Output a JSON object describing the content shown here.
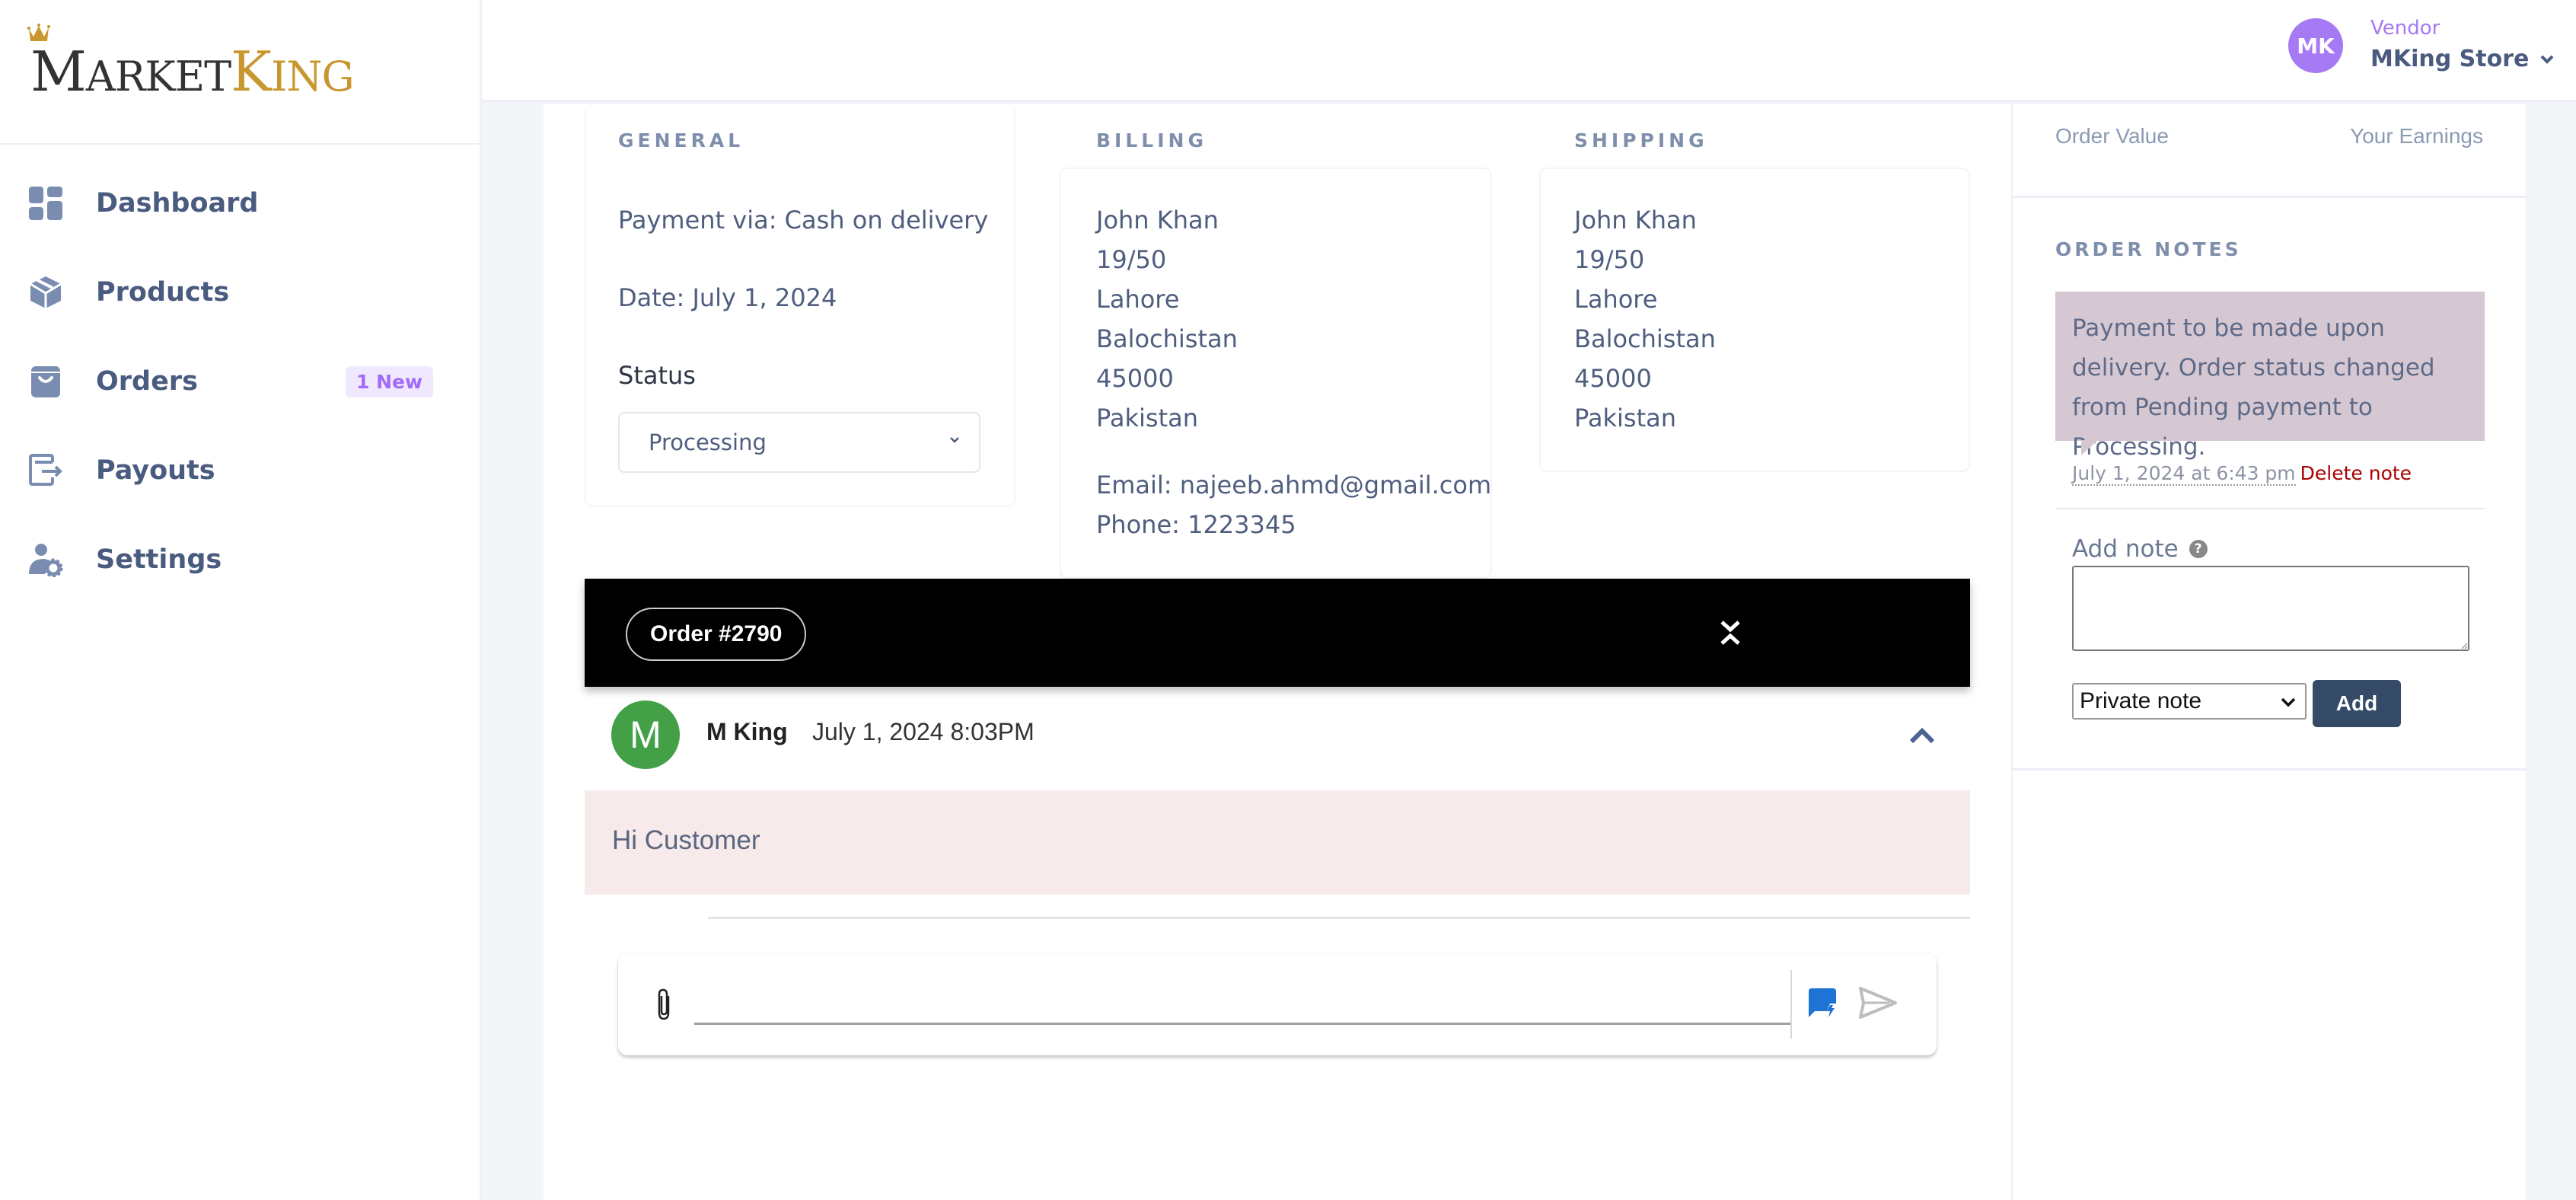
{
  "brand": {
    "name_part1_initial": "M",
    "name_part1_rest": "ARKET",
    "name_part2_initial": "K",
    "name_part2_rest": "ING",
    "primary_color": "#333333",
    "accent_color": "#c9972f"
  },
  "sidebar": {
    "items": [
      {
        "label": "Dashboard",
        "icon": "dashboard-grid-icon"
      },
      {
        "label": "Products",
        "icon": "box-icon"
      },
      {
        "label": "Orders",
        "icon": "shopping-bag-icon",
        "badge": "1 New"
      },
      {
        "label": "Payouts",
        "icon": "payout-export-icon"
      },
      {
        "label": "Settings",
        "icon": "user-settings-icon"
      }
    ]
  },
  "header": {
    "avatar_initials": "MK",
    "role": "Vendor",
    "store_name": "MKing Store",
    "avatar_color": "#a67af4"
  },
  "order": {
    "general": {
      "title": "GENERAL",
      "payment": "Payment via: Cash on delivery",
      "date": "Date: July 1, 2024",
      "status_label": "Status",
      "status_value": "Processing"
    },
    "billing": {
      "title": "BILLING",
      "lines": [
        "John Khan",
        "19/50",
        "Lahore",
        "Balochistan",
        "45000",
        "Pakistan"
      ],
      "email": "Email: najeeb.ahmd@gmail.com",
      "phone": "Phone: 1223345"
    },
    "shipping": {
      "title": "SHIPPING",
      "lines": [
        "John Khan",
        "19/50",
        "Lahore",
        "Balochistan",
        "45000",
        "Pakistan"
      ]
    }
  },
  "chat": {
    "order_pill": "Order #2790",
    "message": {
      "avatar_initial": "M",
      "avatar_color": "#43a047",
      "author": "M King",
      "timestamp": "July 1, 2024 8:03PM",
      "text": "Hi Customer"
    },
    "composer": {
      "value": "",
      "placeholder": ""
    }
  },
  "right_panel": {
    "order_value_label": "Order Value",
    "earnings_label": "Your Earnings",
    "notes_title": "ORDER NOTES",
    "note": {
      "text": "Payment to be made upon delivery. Order status changed from Pending payment to Processing.",
      "date": "July 1, 2024 at 6:43 pm",
      "delete_label": "Delete note"
    },
    "add_note_label": "Add note",
    "add_note_value": "",
    "note_type": "Private note",
    "add_button": "Add"
  }
}
